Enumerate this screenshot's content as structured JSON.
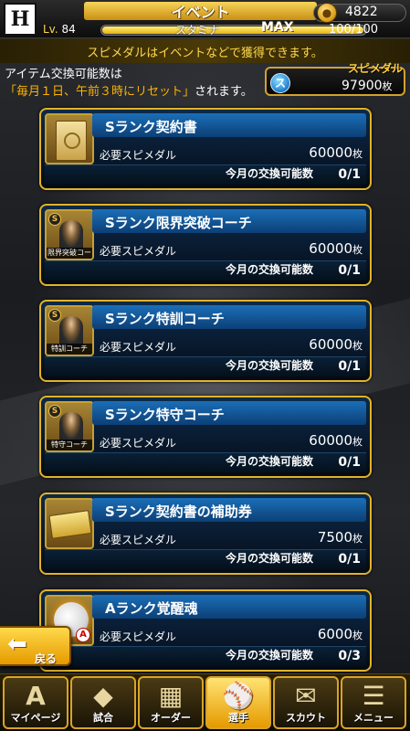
{
  "header": {
    "title": "イベント",
    "level_prefix": "Lv.",
    "level": "84",
    "stamina_label": "スタミナ",
    "stamina_max_label": "MAX",
    "stamina_value": "100/100",
    "stamina_fraction": 1.0,
    "currency_value": "4822"
  },
  "notice": "スピメダルはイベントなどで獲得できます。",
  "info": {
    "line1": "アイテム交換可能数は",
    "line2_highlight": "「毎月１日、午前３時にリセット」",
    "line2_rest": "されます。"
  },
  "medal": {
    "label": "スピメダル",
    "icon_glyph": "ス",
    "value": "97900",
    "unit": "枚"
  },
  "common": {
    "req_label": "必要スピメダル",
    "unit": "枚",
    "limit_label": "今月の交換可能数"
  },
  "items": [
    {
      "name": "Sランク契約書",
      "cost": "60000",
      "limit": "0/1",
      "thumb": "contract",
      "caption": ""
    },
    {
      "name": "Sランク限界突破コーチ",
      "cost": "60000",
      "limit": "0/1",
      "thumb": "coach",
      "caption": "限界突破コーチ"
    },
    {
      "name": "Sランク特訓コーチ",
      "cost": "60000",
      "limit": "0/1",
      "thumb": "coach",
      "caption": "特訓コーチ"
    },
    {
      "name": "Sランク特守コーチ",
      "cost": "60000",
      "limit": "0/1",
      "thumb": "coach",
      "caption": "特守コーチ"
    },
    {
      "name": "Sランク契約書の補助券",
      "cost": "7500",
      "limit": "0/1",
      "thumb": "ticket",
      "caption": ""
    },
    {
      "name": "Aランク覚醒魂",
      "cost": "6000",
      "limit": "0/3",
      "thumb": "soul",
      "caption": ""
    }
  ],
  "back_label": "戻る",
  "nav": [
    {
      "label": "マイページ",
      "glyph": "A",
      "active": false
    },
    {
      "label": "試合",
      "glyph": "◆",
      "active": false
    },
    {
      "label": "オーダー",
      "glyph": "▦",
      "active": false
    },
    {
      "label": "選手",
      "glyph": "⚾",
      "active": true
    },
    {
      "label": "スカウト",
      "glyph": "✉",
      "active": false
    },
    {
      "label": "メニュー",
      "glyph": "☰",
      "active": false
    }
  ],
  "colors": {
    "accent_gold": "#e0b32a",
    "card_blue": "#0b2a4a",
    "notice_yellow": "#ffd84a",
    "highlight_orange": "#ffb300"
  }
}
